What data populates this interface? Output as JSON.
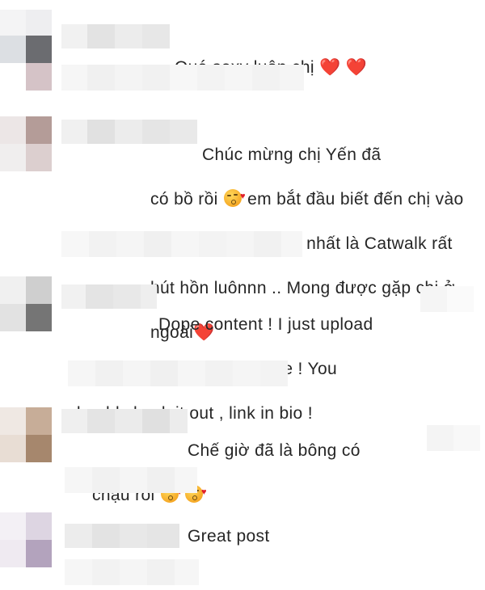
{
  "comments": [
    {
      "text": "Quá sexy luôn chị ",
      "trail": "❤️ ❤️"
    },
    {
      "line1": "Chúc mừng chị Yến đã",
      "line2a": "có bồ rồi ",
      "line2b": " em bắt đầu biết đến chị vào",
      "line3": "năm 2017, quá đẹp nhất là Catwalk rất",
      "line4": "hút hồn luônnn .. Mong được gặp chị ở",
      "line5": "ngoài",
      "trail": "❤️"
    },
    {
      "line1": "Dope content ! I just upload",
      "line2": "an epic video to my YouTube ! You",
      "line3": "should check it out , link in bio !"
    },
    {
      "line1": "Chế giờ đã là bông có",
      "line2": "chậu rồi "
    },
    {
      "text": "Great post"
    }
  ],
  "icons": {
    "kiss_emoji": "face-blowing-kiss-icon",
    "heart": "red-heart-icon"
  }
}
